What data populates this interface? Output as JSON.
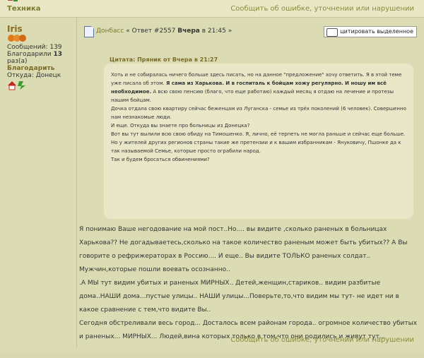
{
  "topbar": {
    "category": "Техника",
    "report_link": "Сообщить об ошибке, уточнении или нарушении"
  },
  "author": {
    "name": "Iris",
    "messages": "Сообщений: 139",
    "thanked_prefix": "Благодарили ",
    "thanked_count": "13",
    "thanked_suffix": "раз(а)",
    "thank_link": "Благодарить",
    "location": "Откуда: Донецк"
  },
  "post": {
    "topic_link": "Донбасс",
    "title_sep": " « ",
    "reply": "Ответ #2557",
    "date_bold": "Вчера",
    "date_rest": " в 21:45 »",
    "cite_button": "цитировать выделенное"
  },
  "quote": {
    "title": "Цитата: Пряник от Вчера в 21:27",
    "paragraphs": [
      {
        "text": "Хоть и не собиралась ничего больше здесь писать, но на данное \"предложение\" хочу ответить. Я в этой теме уже писала об этом. ",
        "bold": "Я сама из Харькова. И в госпиталь к бойцам хожу регулярно. И ношу им всё необходимое.",
        "rest": " А всю свою пенсию (благо, что еще работаю) каждый месяц я отдаю на лечение и протезы нашим бойцам."
      },
      {
        "text": "Дочка отдала свою квартиру сейчас беженцам из Луганска - семье из трёх поколений (6 человек). Совершенно нам незнакомые люди."
      },
      {
        "text": "И еще. Откуда вы знаете про больницы из Донецка?"
      },
      {
        "text": "Вот вы тут вылили всю свою обиду на Тимошенко. Я, лично, её терпеть не могла раньше и сейчас еще больше. Но у жителей других регионов страны такие же претензии и к вашим избранникам - Януковичу, Пшонке да к так называемой Семье, которые просто ограбили народ."
      },
      {
        "text": "Так и будем бросаться обвинениями?"
      }
    ]
  },
  "body": {
    "paragraphs": [
      " Я понимаю Ваше негодование на мой пост..Но.... вы видите ,сколько раненых в больницах Харькова?? Не догадываетесь,сколько на такое количество раненым может быть убитых?? А Вы говорите о рефрижераторах в Россию.... И еще.. Вы видите ТОЛЬКО раненых солдат.. Мужчин,которые пошли воевать осознанно..",
      ".А МЫ тут видим убитых и раненых МИРНЫХ.. Детей,женщин,стариков.. видим разбитые дома..НАШИ дома...пустые улицы.. НАШИ улицы...Поверьте,то,что видим мы тут- не идет ни в какое сравнение с тем,что видите Вы..",
      "Сегодня обстреливали весь город... Досталось всем районам города.. огромное количество убитых и раненых... МИРНЫХ... Людей,вина которых только в том,что они родились и живут тут..."
    ],
    "report_link_bottom": "Сообщить об ошибке, уточнении или нарушении"
  }
}
